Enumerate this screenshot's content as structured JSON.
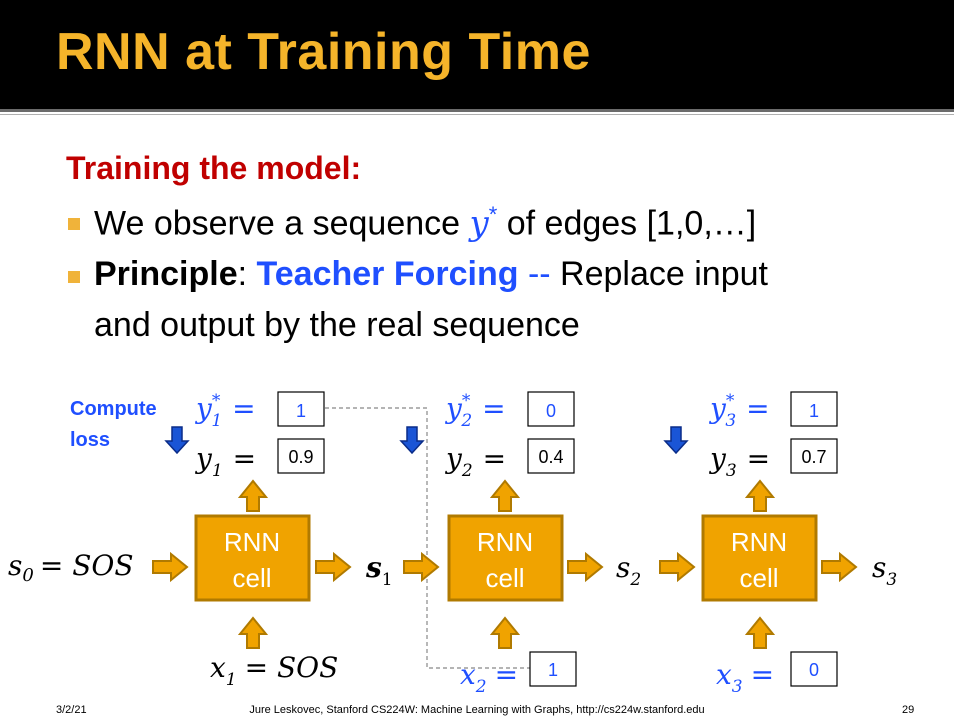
{
  "title": "RNN at Training Time",
  "heading": "Training the model:",
  "bullets": {
    "b1": {
      "pre": "We observe a sequence ",
      "var": "y",
      "sup": "*",
      "post": " of edges [1,0,…]"
    },
    "b2": {
      "lead": "Principle",
      "colon": ": ",
      "tf": "Teacher Forcing",
      "dash": " --",
      "rest": " Replace input",
      "line2": "and output by the real sequence"
    }
  },
  "diagram": {
    "compute_loss_line1": "Compute",
    "compute_loss_line2": "loss",
    "cell_line1": "RNN",
    "cell_line2": "cell",
    "eq": "=",
    "s0": "s",
    "s0_sub": "0",
    "s0_rhs": "= SOS",
    "states": [
      {
        "var": "s",
        "sub": "1",
        "bold": true
      },
      {
        "var": "s",
        "sub": "2",
        "bold": false
      },
      {
        "var": "s",
        "sub": "3",
        "bold": false
      }
    ],
    "steps": [
      {
        "ystar_var": "y",
        "ystar_sub": "1",
        "ystar_val": "1",
        "y_var": "y",
        "y_sub": "1",
        "y_val": "0.9",
        "x_var": "x",
        "x_sub": "1",
        "x_rhs": "= SOS",
        "x_val": ""
      },
      {
        "ystar_var": "y",
        "ystar_sub": "2",
        "ystar_val": "0",
        "y_var": "y",
        "y_sub": "2",
        "y_val": "0.4",
        "x_var": "x",
        "x_sub": "2",
        "x_rhs": "=",
        "x_val": "1"
      },
      {
        "ystar_var": "y",
        "ystar_sub": "3",
        "ystar_val": "1",
        "y_var": "y",
        "y_sub": "3",
        "y_val": "0.7",
        "x_var": "x",
        "x_sub": "3",
        "x_rhs": "=",
        "x_val": "0"
      }
    ]
  },
  "footer": {
    "date": "3/2/21",
    "credit": "Jure Leskovec, Stanford CS224W: Machine Learning with Graphs, http://cs224w.stanford.edu",
    "page": "29"
  },
  "colors": {
    "accent_gold": "#f5b42a",
    "cell_fill": "#f0a300",
    "cell_border": "#b07a00",
    "heading_red": "#c00000",
    "blue": "#1f4fff"
  }
}
